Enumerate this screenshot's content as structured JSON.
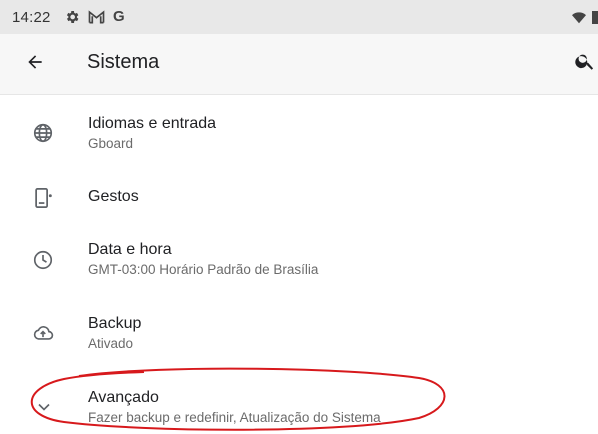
{
  "status_bar": {
    "time": "14:22",
    "icons": [
      "gear-icon",
      "gmail-icon",
      "google-icon",
      "wifi-icon",
      "battery-icon"
    ],
    "google_letter": "G"
  },
  "app_bar": {
    "title": "Sistema",
    "back_icon": "arrow-back-icon",
    "search_icon": "search-icon"
  },
  "settings": {
    "items": [
      {
        "icon": "globe-icon",
        "title": "Idiomas e entrada",
        "subtitle": "Gboard"
      },
      {
        "icon": "gesture-phone-icon",
        "title": "Gestos",
        "subtitle": ""
      },
      {
        "icon": "clock-icon",
        "title": "Data e hora",
        "subtitle": "GMT-03:00 Horário Padrão de Brasília"
      },
      {
        "icon": "cloud-upload-icon",
        "title": "Backup",
        "subtitle": "Ativado"
      },
      {
        "icon": "chevron-down-icon",
        "title": "Avançado",
        "subtitle": "Fazer backup e redefinir, Atualização do Sistema"
      }
    ]
  },
  "annotation": {
    "shape": "ellipse",
    "color": "#d7191c",
    "target": "Avançado"
  },
  "colors": {
    "status_bar_bg": "#e8e8e8",
    "app_bar_bg": "#f7f7f7",
    "text_primary": "#202124",
    "text_secondary": "#6b6b6b",
    "icon": "#5f6368",
    "annotation": "#d7191c"
  }
}
